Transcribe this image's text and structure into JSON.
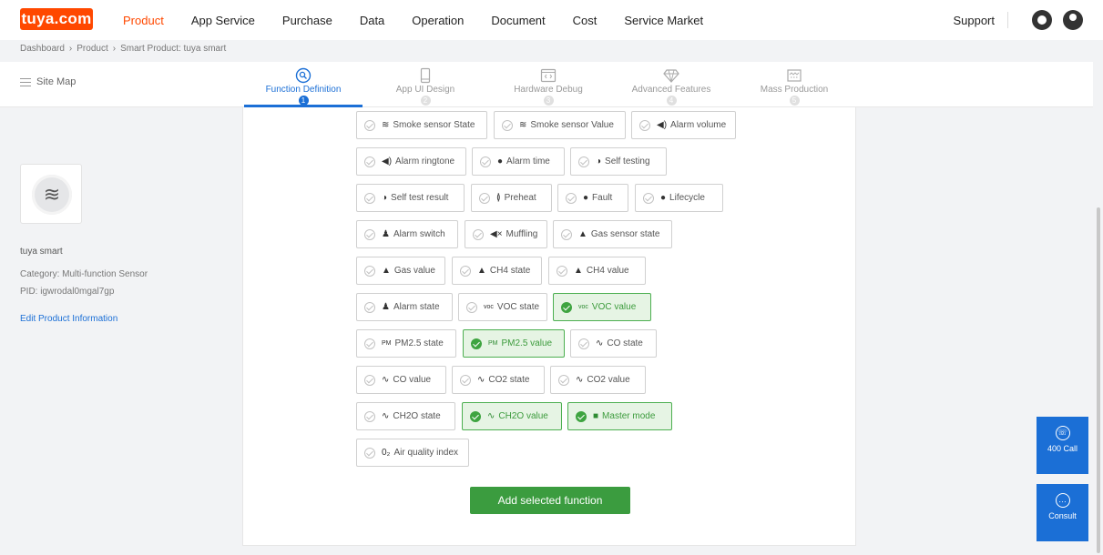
{
  "logo": "tuya.com",
  "nav": {
    "items": [
      "Product",
      "App Service",
      "Purchase",
      "Data",
      "Operation",
      "Document",
      "Cost",
      "Service Market"
    ],
    "support": "Support"
  },
  "breadcrumb": [
    "Dashboard",
    "Product",
    "Smart Product: tuya smart"
  ],
  "sitemap": "Site Map",
  "steps": [
    {
      "label": "Function Definition",
      "num": "1"
    },
    {
      "label": "App UI Design",
      "num": "2"
    },
    {
      "label": "Hardware Debug",
      "num": "3"
    },
    {
      "label": "Advanced Features",
      "num": "4"
    },
    {
      "label": "Mass Production",
      "num": "5"
    }
  ],
  "product": {
    "name": "tuya smart",
    "category": "Category: Multi-function Sensor",
    "pid": "PID: igwrodal0mgal7gp",
    "edit": "Edit Product Information"
  },
  "functions": [
    {
      "label": "Smoke sensor State",
      "icon": "≋",
      "selected": false
    },
    {
      "label": "Smoke sensor Value",
      "icon": "≋",
      "selected": false
    },
    {
      "label": "Alarm volume",
      "icon": "◀)",
      "selected": false
    },
    {
      "label": "Alarm ringtone",
      "icon": "◀)",
      "selected": false
    },
    {
      "label": "Alarm time",
      "icon": "●",
      "selected": false
    },
    {
      "label": "Self testing",
      "icon": "◑",
      "selected": false
    },
    {
      "label": "Self test result",
      "icon": "◑",
      "selected": false
    },
    {
      "label": "Preheat",
      "icon": "≬",
      "selected": false
    },
    {
      "label": "Fault",
      "icon": "●",
      "selected": false
    },
    {
      "label": "Lifecycle",
      "icon": "●",
      "selected": false
    },
    {
      "label": "Alarm switch",
      "icon": "♟",
      "selected": false
    },
    {
      "label": "Muffling",
      "icon": "◀×",
      "selected": false
    },
    {
      "label": "Gas sensor state",
      "icon": "▲",
      "selected": false
    },
    {
      "label": "Gas value",
      "icon": "▲",
      "selected": false
    },
    {
      "label": "CH4 state",
      "icon": "▲",
      "selected": false
    },
    {
      "label": "CH4 value",
      "icon": "▲",
      "selected": false
    },
    {
      "label": "Alarm state",
      "icon": "♟",
      "selected": false
    },
    {
      "label": "VOC state",
      "icon": "voc",
      "selected": false
    },
    {
      "label": "VOC value",
      "icon": "voc",
      "selected": true
    },
    {
      "label": "PM2.5 state",
      "icon": "PM",
      "selected": false
    },
    {
      "label": "PM2.5 value",
      "icon": "PM",
      "selected": true
    },
    {
      "label": "CO state",
      "icon": "∿",
      "selected": false
    },
    {
      "label": "CO value",
      "icon": "∿",
      "selected": false
    },
    {
      "label": "CO2 state",
      "icon": "∿",
      "selected": false
    },
    {
      "label": "CO2 value",
      "icon": "∿",
      "selected": false
    },
    {
      "label": "CH2O state",
      "icon": "∿",
      "selected": false
    },
    {
      "label": "CH2O value",
      "icon": "∿",
      "selected": true
    },
    {
      "label": "Master mode",
      "icon": "■",
      "selected": true
    },
    {
      "label": "Air quality index",
      "icon": "0₂",
      "selected": false
    }
  ],
  "add_button": "Add selected function",
  "fabs": [
    {
      "label": "400 Call"
    },
    {
      "label": "Consult"
    }
  ],
  "colors": {
    "brand": "#ff4800",
    "accent": "#1b6fd6",
    "selected": "#3ea440"
  }
}
